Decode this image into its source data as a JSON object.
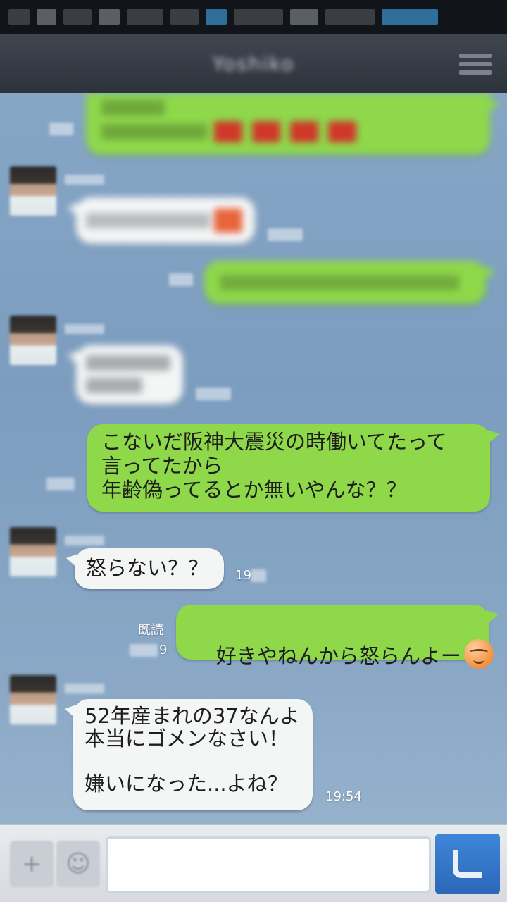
{
  "header": {
    "title": "Yoshiko"
  },
  "messages": {
    "m1": {
      "text": "こないだ阪神大震災の時働いてたって\n言ってたから\n年齢偽ってるとか無いやんな？？"
    },
    "m2": {
      "text": "怒らない？？",
      "time": "19"
    },
    "m3": {
      "text": "好きやねんから怒らんよー",
      "read_label": "既読",
      "time": "9",
      "emoji": "smile-icon"
    },
    "m4": {
      "text": "52年産まれの37なんよ\n本当にゴメンなさい！\n\n嫌いになった...よね？",
      "time": "19:54"
    }
  },
  "input": {
    "placeholder": ""
  },
  "colors": {
    "sent_bubble": "#8ed84a",
    "received_bubble": "#f4f5f5",
    "header": "#2d333b",
    "send_button": "#2b67b8"
  }
}
